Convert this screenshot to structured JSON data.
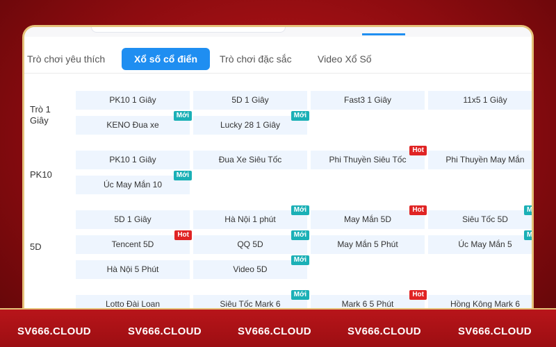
{
  "tabs": [
    {
      "label": "Trò chơi yêu thích"
    },
    {
      "label": "Xổ số cổ điển"
    },
    {
      "label": "Trò chơi đặc sắc"
    },
    {
      "label": "Video Xổ Số"
    }
  ],
  "sections": [
    {
      "label": "Trò 1 Giây"
    },
    {
      "label": "PK10"
    },
    {
      "label": "5D"
    }
  ],
  "games": [
    {
      "label": "PK10 1 Giây",
      "badge": ""
    },
    {
      "label": "5D 1 Giây",
      "badge": ""
    },
    {
      "label": "Fast3 1 Giây",
      "badge": ""
    },
    {
      "label": "11x5 1 Giây",
      "badge": ""
    },
    {
      "label": "KENO Đua xe",
      "badge": "Mới"
    },
    {
      "label": "Lucky 28 1 Giây",
      "badge": "Mới"
    },
    {
      "label": "PK10 1 Giây",
      "badge": ""
    },
    {
      "label": "Đua Xe Siêu Tốc",
      "badge": ""
    },
    {
      "label": "Phi Thuyền Siêu Tốc",
      "badge": "Hot"
    },
    {
      "label": "Phi Thuyền May Mắn",
      "badge": ""
    },
    {
      "label": "Úc May Mắn 10",
      "badge": "Mới"
    },
    {
      "label": "5D 1 Giây",
      "badge": ""
    },
    {
      "label": "Hà Nội 1 phút",
      "badge": "Mới"
    },
    {
      "label": "May Mắn 5D",
      "badge": "Hot"
    },
    {
      "label": "Siêu Tốc 5D",
      "badge": "M"
    },
    {
      "label": "Tencent 5D",
      "badge": "Hot"
    },
    {
      "label": "QQ 5D",
      "badge": "Mới"
    },
    {
      "label": "May Mắn 5 Phút",
      "badge": ""
    },
    {
      "label": "Úc May Mắn 5",
      "badge": "M"
    },
    {
      "label": "Hà Nội 5 Phút",
      "badge": ""
    },
    {
      "label": "Video 5D",
      "badge": "Mới"
    },
    {
      "label": "Lotto Đài Loan",
      "badge": ""
    },
    {
      "label": "Siêu Tốc Mark 6",
      "badge": "Mới"
    },
    {
      "label": "Mark 6 5 Phút",
      "badge": "Hot"
    },
    {
      "label": "Hồng Kông Mark 6",
      "badge": ""
    }
  ],
  "watermark": "SV666.CLOUD",
  "colors": {
    "accent": "#1f8ef1",
    "new_badge": "#1bb0b6",
    "hot_badge": "#e02424",
    "frame_gold": "#e6c27a",
    "background_red": "#a8101a"
  }
}
